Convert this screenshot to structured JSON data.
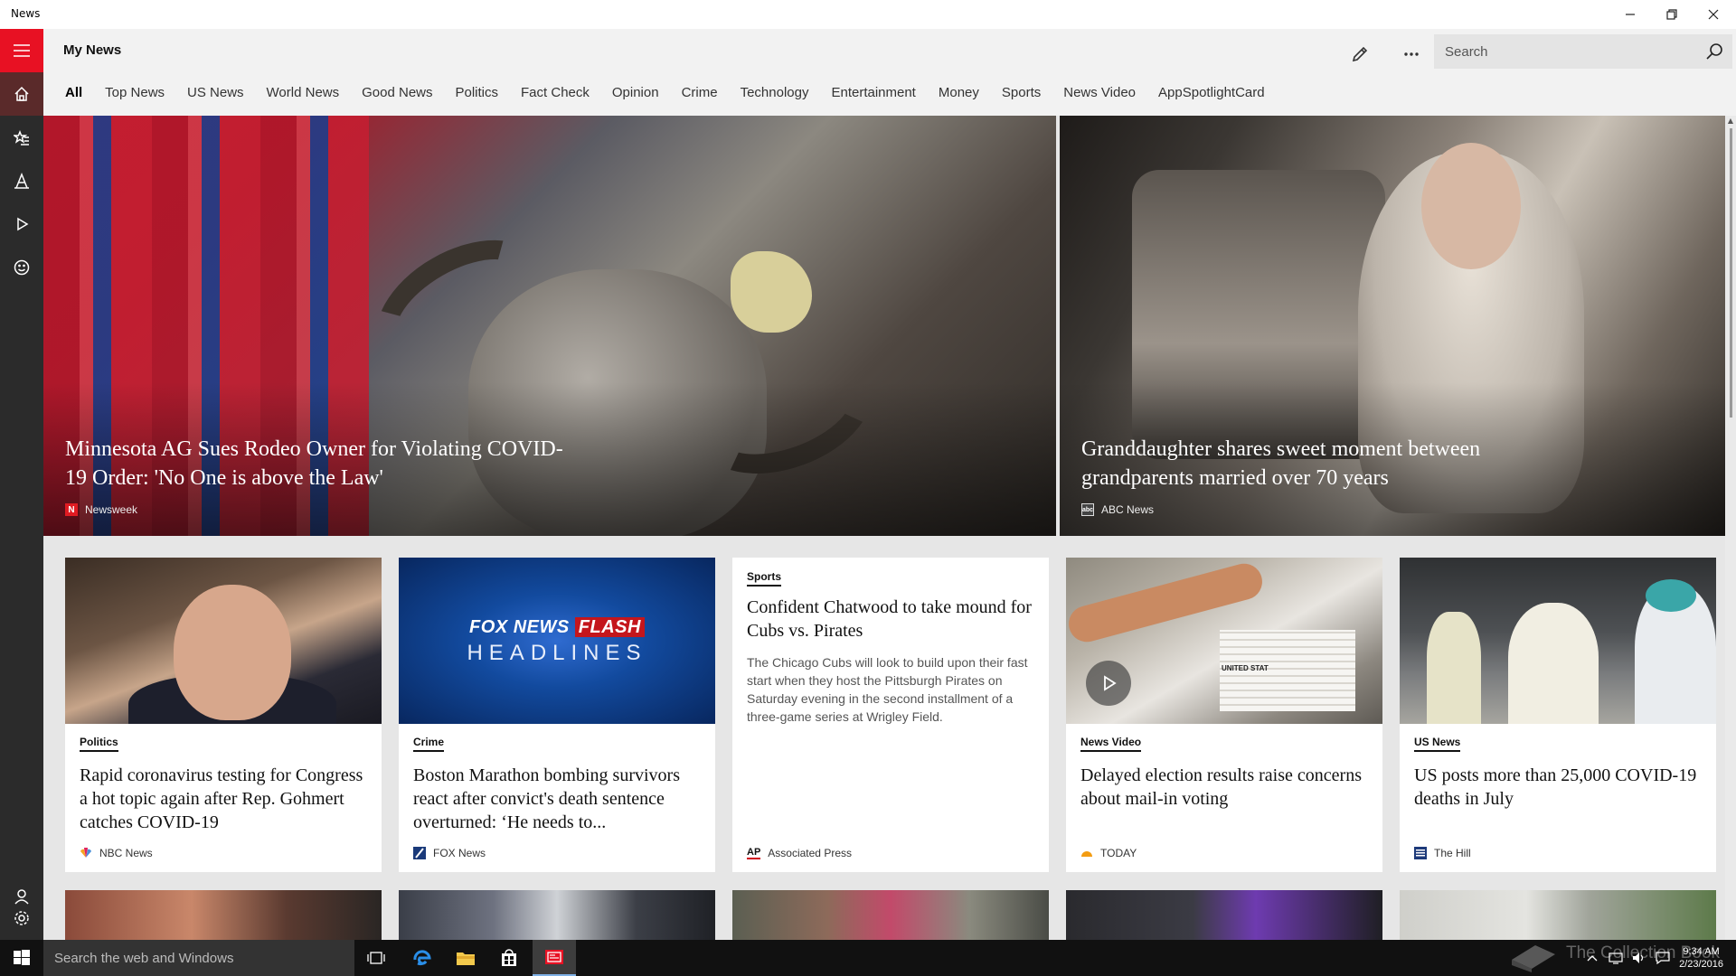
{
  "window": {
    "app_name": "News",
    "minimize_label": "Minimize",
    "maximize_label": "Maximize",
    "close_label": "Close"
  },
  "header": {
    "title": "My News",
    "search_placeholder": "Search",
    "tabs": [
      {
        "label": "All",
        "active": true
      },
      {
        "label": "Top News"
      },
      {
        "label": "US News"
      },
      {
        "label": "World News"
      },
      {
        "label": "Good News"
      },
      {
        "label": "Politics"
      },
      {
        "label": "Fact Check"
      },
      {
        "label": "Opinion"
      },
      {
        "label": "Crime"
      },
      {
        "label": "Technology"
      },
      {
        "label": "Entertainment"
      },
      {
        "label": "Money"
      },
      {
        "label": "Sports"
      },
      {
        "label": "News Video"
      },
      {
        "label": "AppSpotlightCard"
      }
    ]
  },
  "rail": {
    "items": [
      "hamburger-icon",
      "home-icon",
      "star-icon",
      "local-icon",
      "video-icon",
      "smiley-icon",
      "profile-icon",
      "settings-icon"
    ],
    "accent": "#e81123"
  },
  "hero": [
    {
      "title": "Minnesota AG Sues Rodeo Owner for Violating COVID-19 Order: 'No One is above the Law'",
      "source": "Newsweek",
      "source_logo": "N",
      "source_color": "#e01b22"
    },
    {
      "title": "Granddaughter shares sweet moment between grandparents married over 70 years",
      "source": "ABC News",
      "source_logo": "abc",
      "source_color": "#333333"
    }
  ],
  "cards": [
    {
      "category": "Politics",
      "title": "Rapid coronavirus testing for Congress a hot topic again after Rep. Gohmert catches COVID-19",
      "source": "NBC News",
      "source_color": "#f5a623"
    },
    {
      "category": "Crime",
      "title": "Boston Marathon bombing survivors react after convict's death sentence overturned: ‘He needs to...",
      "source": "FOX News",
      "source_color": "#1a3a7a",
      "image_text_top": "FOX NEWS",
      "image_text_flash": "FLASH",
      "image_text_bottom": "HEADLINES"
    },
    {
      "category": "Sports",
      "title": "Confident Chatwood to take mound for Cubs vs. Pirates",
      "description": "The Chicago Cubs will look to build upon their fast start when they host the Pittsburgh Pirates on Saturday evening in the second installment of a three-game series at Wrigley Field.",
      "source": "Associated Press",
      "source_logo": "AP"
    },
    {
      "category": "News Video",
      "title": "Delayed election results raise concerns about mail-in voting",
      "source": "TODAY",
      "source_color": "#f39c12",
      "image_text": "UNITED STAT"
    },
    {
      "category": "US News",
      "title": "US posts more than 25,000 COVID-19 deaths in July",
      "source": "The Hill",
      "source_color": "#1d3a7a"
    }
  ],
  "taskbar": {
    "search_placeholder": "Search the web and Windows",
    "time": "9:34 AM",
    "date": "2/23/2016",
    "pinned": [
      "task-view-icon",
      "edge-icon",
      "file-explorer-icon",
      "store-icon",
      "news-app-icon"
    ]
  },
  "watermark": "The Collection Book"
}
